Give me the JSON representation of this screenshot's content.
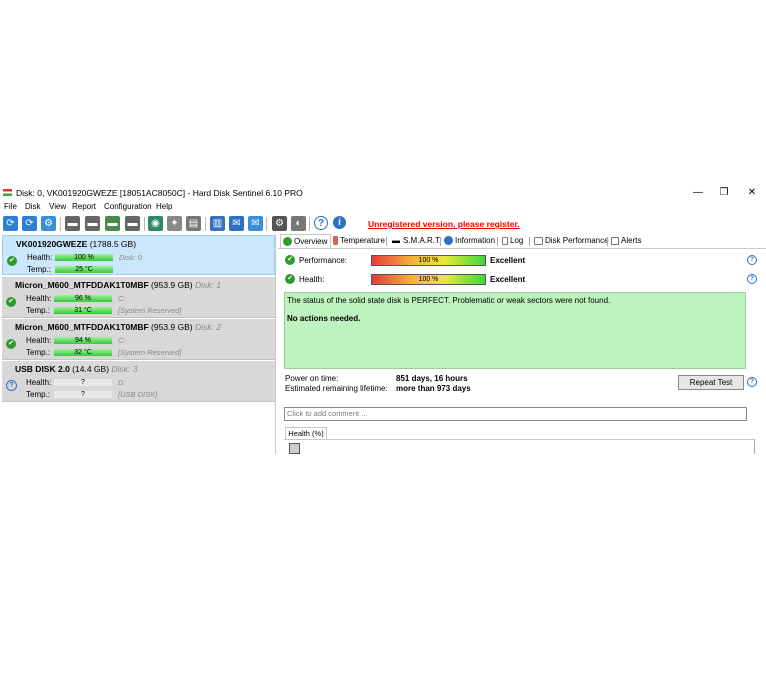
{
  "window": {
    "title": "Disk: 0, VK001920GWEZE [18051AC8050C]  -  Hard Disk Sentinel 6.10 PRO",
    "minimize": "—",
    "maximize": "❐",
    "close": "✕"
  },
  "menu": [
    "File",
    "Disk",
    "View",
    "Report",
    "Configuration",
    "Help"
  ],
  "toolbar": {
    "unregistered": "Unregistered version, please register."
  },
  "disks": [
    {
      "name": "VK001920GWEZE",
      "size": "(1788.5 GB)",
      "num": "Disk: 0",
      "health_label": "Health:",
      "health": "100 %",
      "health_pct": 100,
      "temp_label": "Temp.:",
      "temp": "25 °C",
      "health_extra": "Disk: 0",
      "temp_extra": "",
      "status": "ok"
    },
    {
      "name": "Micron_M600_MTFDDAK1T0MBF",
      "size": "(953.9 GB)",
      "num": "Disk: 1",
      "health_label": "Health:",
      "health": "96 %",
      "health_pct": 96,
      "temp_label": "Temp.:",
      "temp": "31 °C",
      "health_extra": "C:",
      "temp_extra": "[System Reserved]",
      "status": "ok"
    },
    {
      "name": "Micron_M600_MTFDDAK1T0MBF",
      "size": "(953.9 GB)",
      "num": "Disk: 2",
      "health_label": "Health:",
      "health": "94 %",
      "health_pct": 94,
      "temp_label": "Temp.:",
      "temp": "32 °C",
      "health_extra": "C:",
      "temp_extra": "[System Reserved]",
      "status": "ok"
    },
    {
      "name": "USB DISK 2.0",
      "size": "(14.4 GB)",
      "num": "Disk: 3",
      "health_label": "Health:",
      "health": "?",
      "health_pct": 0,
      "temp_label": "Temp.:",
      "temp": "?",
      "health_extra": "D:",
      "temp_extra": "[USB DISK]",
      "status": "unknown"
    }
  ],
  "tabs": [
    "Overview",
    "Temperature",
    "S.M.A.R.T.",
    "Information",
    "Log",
    "Disk Performance",
    "Alerts"
  ],
  "overview": {
    "performance_label": "Performance:",
    "performance_value": "100 %",
    "performance_rating": "Excellent",
    "health_label": "Health:",
    "health_value": "100 %",
    "health_rating": "Excellent",
    "status_text": "The status of the solid state disk is PERFECT. Problematic or weak sectors were not found.",
    "actions_text": "No actions needed.",
    "power_on_label": "Power on time:",
    "power_on_value": "851 days, 16 hours",
    "lifetime_label": "Estimated remaining lifetime:",
    "lifetime_value": "more than 973 days",
    "repeat_test": "Repeat Test",
    "comment_placeholder": "Click to add comment ...",
    "history_tab": "Health (%)"
  },
  "colors": {
    "accent": "#2d6fc2",
    "ok": "#2f9b2f",
    "status_bg": "#bef2be",
    "warning": "#e00000"
  }
}
